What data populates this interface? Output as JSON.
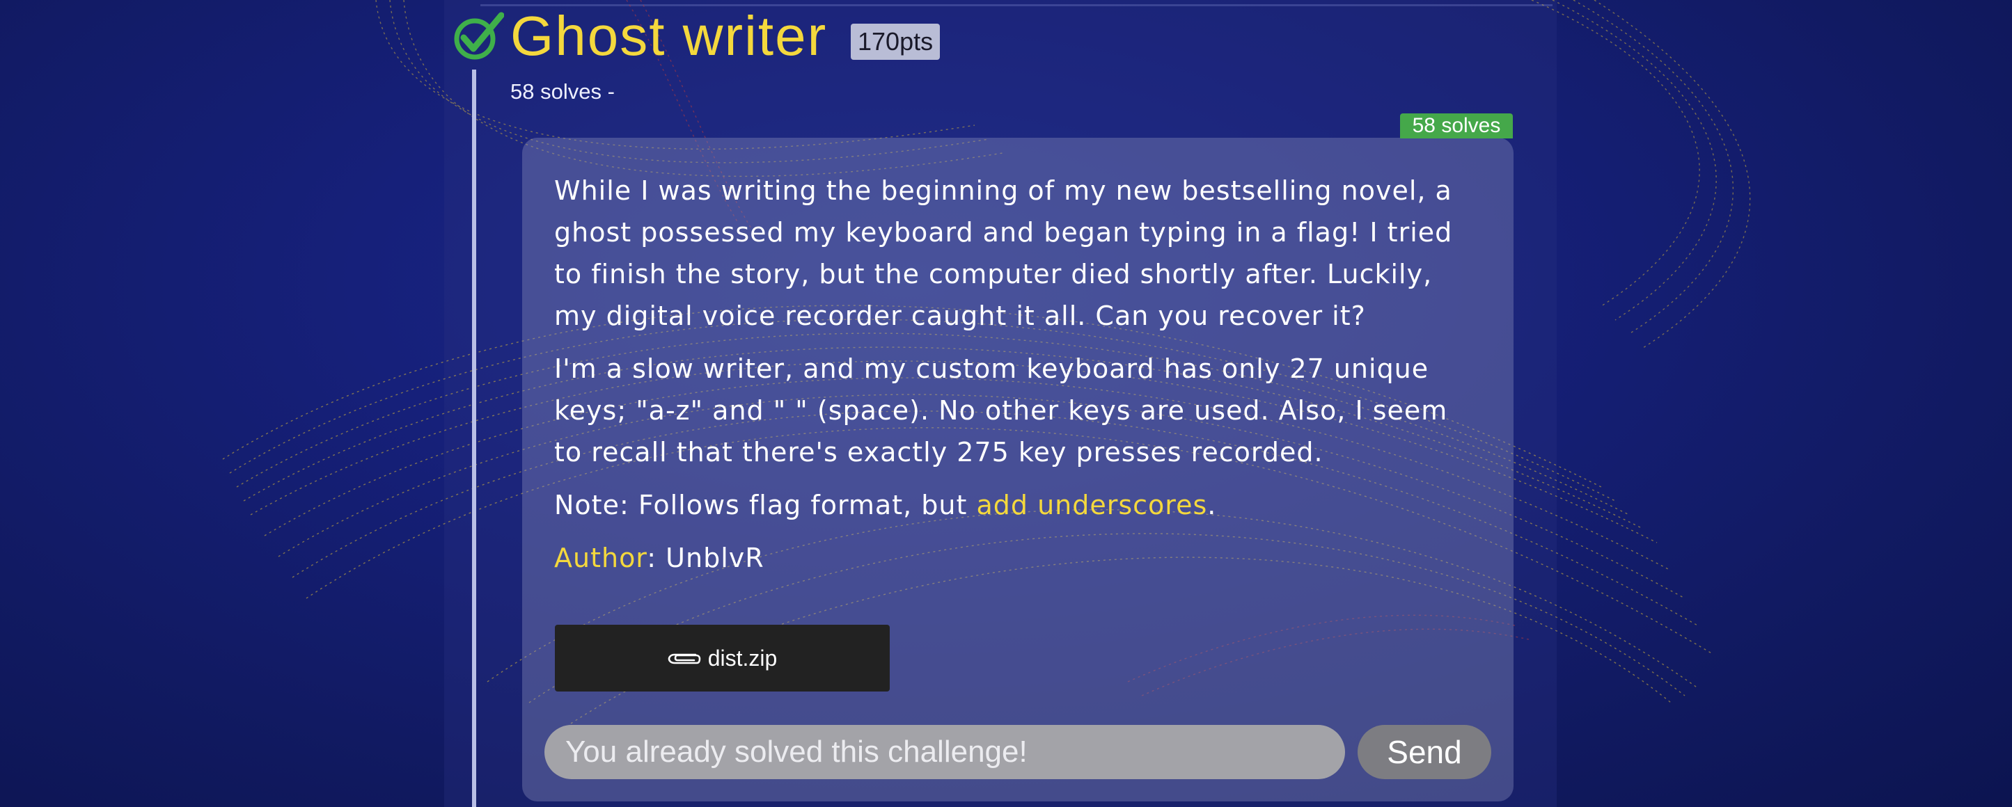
{
  "challenge": {
    "title": "Ghost writer",
    "points": "170pts",
    "solves_subtitle": "58 solves -",
    "solves_badge": "58 solves",
    "solved": true
  },
  "description": {
    "paragraph1": "While I was writing the beginning of my new bestselling novel, a ghost possessed my keyboard and began typing in a flag! I tried to finish the story, but the computer died shortly after. Luckily, my digital voice recorder caught it all. Can you recover it?",
    "paragraph2": "I'm a slow writer, and my custom keyboard has only 27 unique keys; \"a-z\" and \" \" (space). No other keys are used. Also, I seem to recall that there's exactly 275 key presses recorded.",
    "note_prefix": "Note: Follows flag format, but ",
    "note_highlight": "add underscores",
    "note_suffix": ".",
    "author_label": "Author",
    "author_separator": ": ",
    "author_name": "UnblvR"
  },
  "attachment": {
    "filename": "dist.zip",
    "icon": "paperclip-icon"
  },
  "flag_form": {
    "placeholder": "You already solved this challenge!",
    "value": "",
    "send_label": "Send"
  },
  "colors": {
    "accent_yellow": "#f4d83d",
    "solved_green": "#45a84a",
    "background": "#16207a"
  }
}
